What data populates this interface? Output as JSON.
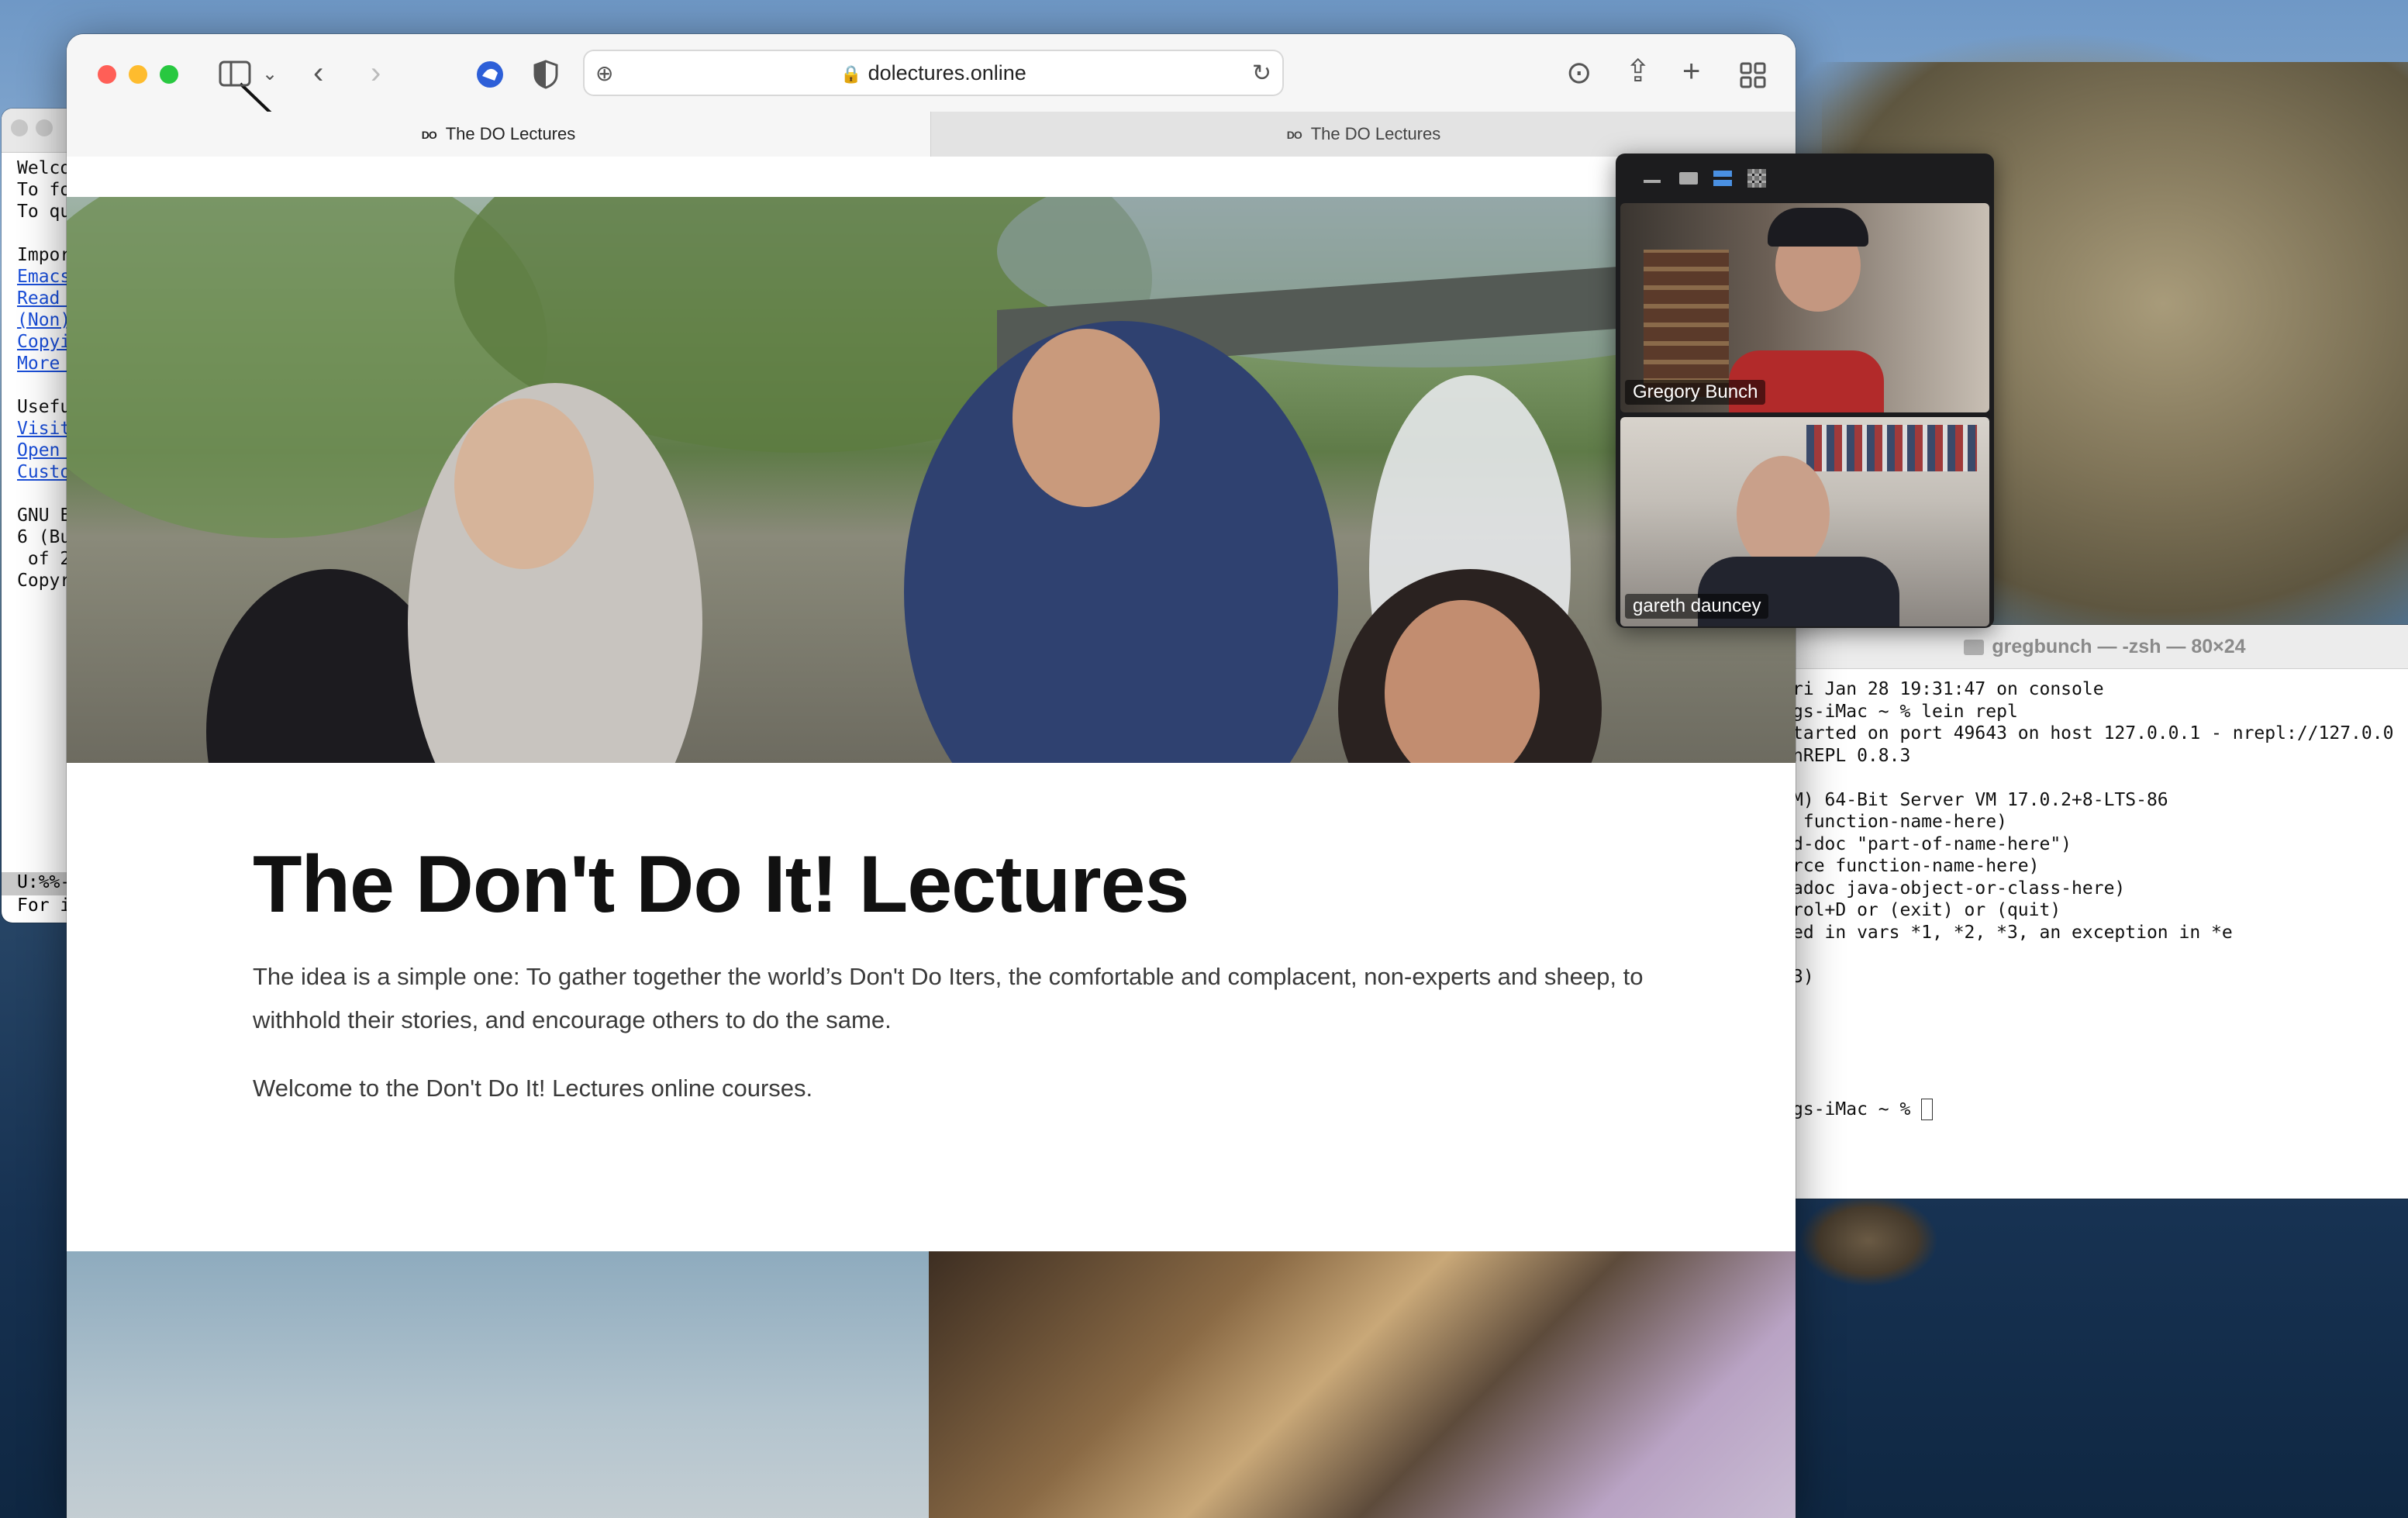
{
  "emacs": {
    "lines": [
      "Welco",
      "To fo",
      "To qu",
      "",
      "Impor"
    ],
    "links": [
      "Emacs",
      "Read ",
      "(Non)",
      "Copyi",
      "More "
    ],
    "useful": "Usefu",
    "links2": [
      "Visit",
      "Open ",
      "Custo"
    ],
    "gnu": [
      "GNU E",
      "6 (Bu",
      " of 2",
      "Copyr"
    ],
    "mode_line": "U:%%-",
    "minibuffer": "For i"
  },
  "terminal": {
    "title": "gregbunch — -zsh — 80×24",
    "lines": [
      "ri Jan 28 19:31:47 on console",
      "gs-iMac ~ % lein repl",
      "tarted on port 49643 on host 127.0.0.1 - nrepl://127.0.0",
      "nREPL 0.8.3",
      "",
      "M) 64-Bit Server VM 17.0.2+8-LTS-86",
      " function-name-here)",
      "d-doc \"part-of-name-here\")",
      "rce function-name-here)",
      "adoc java-object-or-class-here)",
      "rol+D or (exit) or (quit)",
      "ed in vars *1, *2, *3, an exception in *e",
      "",
      "3)",
      "",
      "",
      "",
      "",
      ""
    ],
    "prompt": "gs-iMac ~ % "
  },
  "safari": {
    "url": "dolectures.online",
    "tabs": [
      {
        "label": "The DO Lectures",
        "favicon": "DO"
      },
      {
        "label": "The DO Lectures",
        "favicon": "DO"
      }
    ]
  },
  "page": {
    "headline": "The Don't Do It! Lectures",
    "para1": "The idea is a simple one: To gather together the world’s Don't Do Iters, the comfortable and complacent, non-experts and sheep, to withhold their stories, and encourage others to do the same.",
    "para2": "Welcome to the Don't Do It! Lectures online courses."
  },
  "call": {
    "participants": [
      {
        "name": "Gregory Bunch"
      },
      {
        "name": "gareth dauncey"
      }
    ]
  },
  "colors": {
    "close": "#ff5f57",
    "minimize": "#febc2e",
    "maximize": "#28c840",
    "active_view": "#4a90e2"
  }
}
